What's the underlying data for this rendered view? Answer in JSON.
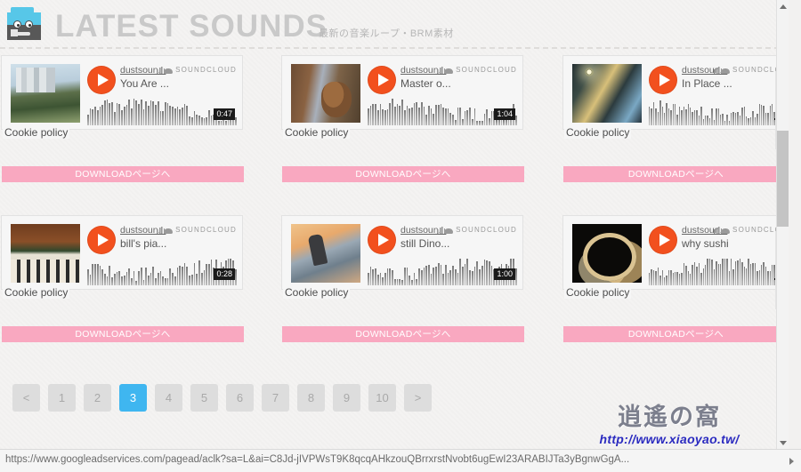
{
  "header": {
    "title": "LATEST SOUNDS",
    "subtitle": "最新の音楽ループ・BRM素材",
    "logo_icon": "robot-mascot-icon"
  },
  "soundcloud": {
    "brand_label": "SOUNDCLOUD",
    "cookie_policy_label": "Cookie policy",
    "play_icon": "play-icon",
    "cloud_icon": "soundcloud-cloud-icon"
  },
  "download_button_label": "DOWNLOADページへ",
  "cards": [
    {
      "artwork": "city-buildings",
      "user": "dustsoun...",
      "track": "You Are ...",
      "duration": "0:47",
      "download_label": "DOWNLOADページへ",
      "cookie_policy": "Cookie policy",
      "brand": "SOUNDCLOUD"
    },
    {
      "artwork": "squirrel-on-tree",
      "user": "dustsoun...",
      "track": "Master o...",
      "duration": "1:04",
      "download_label": "DOWNLOADページへ",
      "cookie_policy": "Cookie policy",
      "brand": "SOUNDCLOUD"
    },
    {
      "artwork": "sunlit-forest",
      "user": "dustsoun...",
      "track": "In Place ...",
      "duration": "",
      "download_label": "DOWNLOADページへ",
      "cookie_policy": "Cookie policy",
      "brand": "SOUNDCLO"
    },
    {
      "artwork": "old-piano-keys",
      "user": "dustsoun...",
      "track": "bill's pia...",
      "duration": "0:28",
      "download_label": "DOWNLOADページへ",
      "cookie_policy": "Cookie policy",
      "brand": "SOUNDCLOUD"
    },
    {
      "artwork": "skateboarder-sunset",
      "user": "dustsoun...",
      "track": "still Dino...",
      "duration": "1:00",
      "download_label": "DOWNLOADページへ",
      "cookie_policy": "Cookie policy",
      "brand": "SOUNDCLOUD"
    },
    {
      "artwork": "fire-spinning-night",
      "user": "dustsoun...",
      "track": "why sushi",
      "duration": "",
      "download_label": "DOWNLOADページへ",
      "cookie_policy": "Cookie policy",
      "brand": "SOUNDCLO"
    }
  ],
  "pagination": {
    "prev_label": "<",
    "next_label": ">",
    "pages": [
      "1",
      "2",
      "3",
      "4",
      "5",
      "6",
      "7",
      "8",
      "9",
      "10"
    ],
    "active_page": "3"
  },
  "watermark": {
    "cjk": "逍遙の窩",
    "url": "http://www.xiaoyao.tw/"
  },
  "status_bar": {
    "url": "https://www.googleadservices.com/pagead/aclk?sa=L&ai=C8Jd-jIVPWsT9K8qcqAHkzouQBrrxrstNvobt6ugEwI23ARABIJTa3yBgnwGgA..."
  },
  "colors": {
    "accent_blue": "#3fb6f0",
    "download_pink": "#f9a8c0",
    "soundcloud_orange": "#f2501e",
    "title_gray": "#c9c9c9",
    "page_background": "#f4f3f2"
  }
}
